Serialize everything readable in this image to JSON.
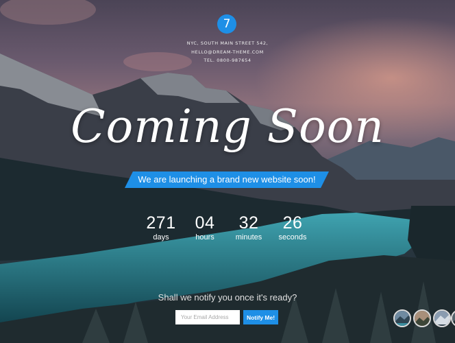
{
  "logo": {
    "text": "7"
  },
  "address": {
    "line1": "NYC, SOUTH MAIN STREET 542,",
    "line2": "HELLO@DREAM-THEME.COM",
    "line3": "TEL. 0800-987654"
  },
  "hero": {
    "title": "Coming Soon",
    "ribbon_text": "We are launching a brand new website soon!"
  },
  "countdown": [
    {
      "value": "271",
      "label": "days"
    },
    {
      "value": "04",
      "label": "hours"
    },
    {
      "value": "32",
      "label": "minutes"
    },
    {
      "value": "26",
      "label": "seconds"
    }
  ],
  "notify": {
    "question": "Shall we notify you once it's ready?",
    "placeholder": "Your Email Address",
    "button": "Notify Me!"
  },
  "colors": {
    "accent": "#1e8fe6"
  },
  "thumbnails": [
    "mountain-lake",
    "mountain-dusk",
    "mountain-snow",
    "mountain-forest"
  ]
}
